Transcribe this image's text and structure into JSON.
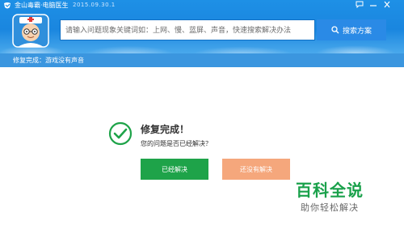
{
  "titlebar": {
    "title": "金山毒霸·电脑医生",
    "date": "2015.09.30.1"
  },
  "search": {
    "placeholder": "请输入问题现象关键词如：上网、慢、蓝屏、声音，快速搜索解决办法",
    "button_label": "搜索方案"
  },
  "status": {
    "text": "修复完成：游戏没有声音"
  },
  "result": {
    "title": "修复完成！",
    "question": "您的问题是否已经解决？",
    "solved_label": "已经解决",
    "unsolved_label": "还没有解决"
  },
  "watermark": {
    "title": "百科全说",
    "subtitle": "助你轻松解决"
  },
  "colors": {
    "header_blue": "#1e90e6",
    "status_blue": "#3b96df",
    "success_green": "#1ea349",
    "unsolved_orange": "#f5a77c"
  }
}
